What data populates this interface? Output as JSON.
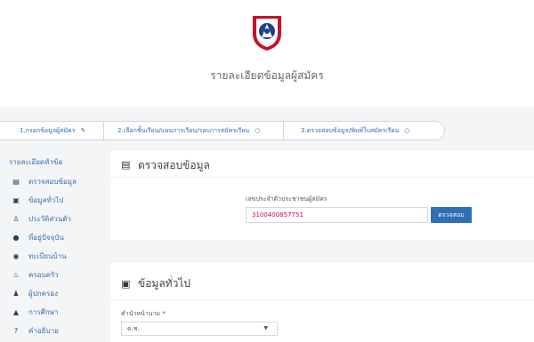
{
  "header": {
    "title": "รายละเอียดข้อมูลผู้สมัคร",
    "logo_icon": "school-emblem-icon"
  },
  "stepper": {
    "steps": [
      {
        "label": "1.กรอกข้อมูลผู้สมัคร",
        "icon": "✎"
      },
      {
        "label": "2.เลือกชั้นเรียน/แผนการเรียน/รอบการสมัครเรียน",
        "icon": "○"
      },
      {
        "label": "3.ตรวจสอบข้อมูล/พิมพ์ใบสมัครเรียน",
        "icon": "○"
      }
    ]
  },
  "sidebar": {
    "title": "รายละเอียดหัวข้อ",
    "items": [
      {
        "label": "ตรวจสอบข้อมูล",
        "icon": "▤",
        "icon_name": "id-card-icon"
      },
      {
        "label": "ข้อมูลทั่วไป",
        "icon": "▣",
        "icon_name": "info-box-icon"
      },
      {
        "label": "ประวัติส่วนตัว",
        "icon": "♙",
        "icon_name": "user-icon"
      },
      {
        "label": "ที่อยู่ปัจจุบัน",
        "icon": "●",
        "icon_name": "map-marker-icon"
      },
      {
        "label": "ทะเบียนบ้าน",
        "icon": "◉",
        "icon_name": "globe-icon"
      },
      {
        "label": "ครอบครัว",
        "icon": "♨",
        "icon_name": "family-icon"
      },
      {
        "label": "ผู้ปกครอง",
        "icon": "♟",
        "icon_name": "guardian-icon"
      },
      {
        "label": "การศึกษา",
        "icon": "▲",
        "icon_name": "graduation-cap-icon"
      },
      {
        "label": "คำอธิบาย",
        "icon": "?",
        "icon_name": "question-icon"
      }
    ]
  },
  "verify_card": {
    "title": "ตรวจสอบข้อมูล",
    "icon": "▤",
    "id_label": "เลขประจำตัวประชาชนผู้สมัคร",
    "id_value": "3100400857751",
    "check_button": "ตรวจสอบ"
  },
  "general_card": {
    "title": "ข้อมูลทั่วไป",
    "icon": "▣",
    "prefix_label": "คำนำหน้านาม *",
    "prefix_value": "ด.ช."
  },
  "colors": {
    "accent": "#2f6fb5",
    "link": "#3a6fa8",
    "shield_red": "#c8102e",
    "shield_blue": "#1f3f8f"
  }
}
